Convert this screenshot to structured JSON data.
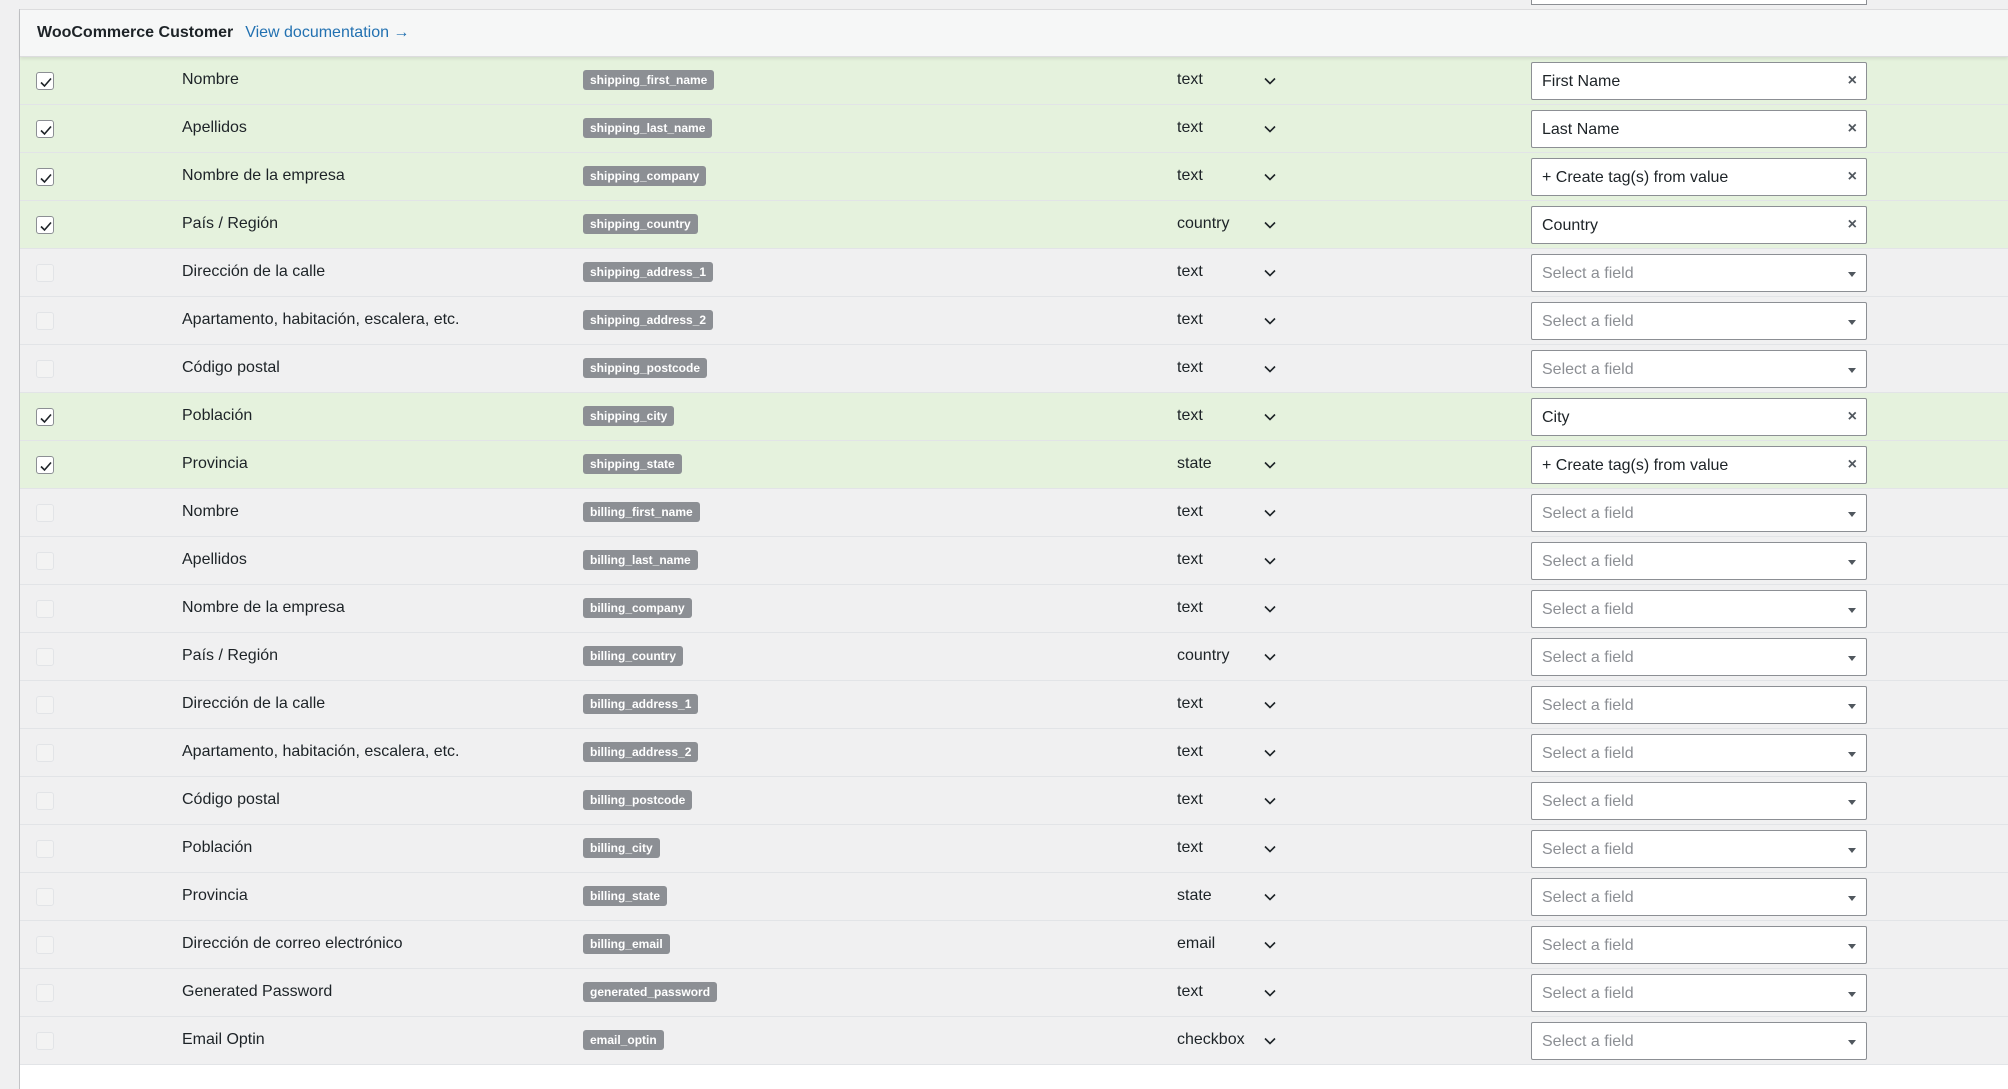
{
  "header": {
    "title": "WooCommerce Customer",
    "doc_link": "View documentation →"
  },
  "placeholder": "Select a field",
  "rows": [
    {
      "checked": true,
      "label": "Nombre",
      "key": "shipping_first_name",
      "type": "text",
      "value": "First Name"
    },
    {
      "checked": true,
      "label": "Apellidos",
      "key": "shipping_last_name",
      "type": "text",
      "value": "Last Name"
    },
    {
      "checked": true,
      "label": "Nombre de la empresa",
      "key": "shipping_company",
      "type": "text",
      "value": "+ Create tag(s) from value"
    },
    {
      "checked": true,
      "label": "País / Región",
      "key": "shipping_country",
      "type": "country",
      "value": "Country"
    },
    {
      "checked": false,
      "label": "Dirección de la calle",
      "key": "shipping_address_1",
      "type": "text",
      "value": ""
    },
    {
      "checked": false,
      "label": "Apartamento, habitación, escalera, etc.",
      "key": "shipping_address_2",
      "type": "text",
      "value": ""
    },
    {
      "checked": false,
      "label": "Código postal",
      "key": "shipping_postcode",
      "type": "text",
      "value": ""
    },
    {
      "checked": true,
      "label": "Población",
      "key": "shipping_city",
      "type": "text",
      "value": "City"
    },
    {
      "checked": true,
      "label": "Provincia",
      "key": "shipping_state",
      "type": "state",
      "value": "+ Create tag(s) from value"
    },
    {
      "checked": false,
      "label": "Nombre",
      "key": "billing_first_name",
      "type": "text",
      "value": ""
    },
    {
      "checked": false,
      "label": "Apellidos",
      "key": "billing_last_name",
      "type": "text",
      "value": ""
    },
    {
      "checked": false,
      "label": "Nombre de la empresa",
      "key": "billing_company",
      "type": "text",
      "value": ""
    },
    {
      "checked": false,
      "label": "País / Región",
      "key": "billing_country",
      "type": "country",
      "value": ""
    },
    {
      "checked": false,
      "label": "Dirección de la calle",
      "key": "billing_address_1",
      "type": "text",
      "value": ""
    },
    {
      "checked": false,
      "label": "Apartamento, habitación, escalera, etc.",
      "key": "billing_address_2",
      "type": "text",
      "value": ""
    },
    {
      "checked": false,
      "label": "Código postal",
      "key": "billing_postcode",
      "type": "text",
      "value": ""
    },
    {
      "checked": false,
      "label": "Población",
      "key": "billing_city",
      "type": "text",
      "value": ""
    },
    {
      "checked": false,
      "label": "Provincia",
      "key": "billing_state",
      "type": "state",
      "value": ""
    },
    {
      "checked": false,
      "label": "Dirección de correo electrónico",
      "key": "billing_email",
      "type": "email",
      "value": ""
    },
    {
      "checked": false,
      "label": "Generated Password",
      "key": "generated_password",
      "type": "text",
      "value": ""
    },
    {
      "checked": false,
      "label": "Email Optin",
      "key": "email_optin",
      "type": "checkbox",
      "value": ""
    }
  ]
}
